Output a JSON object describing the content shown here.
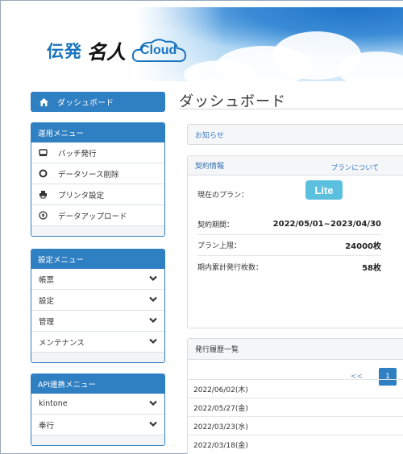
{
  "banner": {
    "logo_den": "伝発",
    "logo_meijin": "名人",
    "logo_cloud": "Cloud"
  },
  "sidebar": {
    "dashboard_label": "ダッシュボード",
    "operation_menu": {
      "title": "運用メニュー",
      "items": [
        {
          "label": "バッチ発行",
          "icon": "printer-tray-icon"
        },
        {
          "label": "データソース削除",
          "icon": "circle-icon"
        },
        {
          "label": "プリンタ設定",
          "icon": "printer-icon"
        },
        {
          "label": "データアップロード",
          "icon": "upload-icon"
        }
      ]
    },
    "settings_menu": {
      "title": "設定メニュー",
      "items": [
        {
          "label": "帳票"
        },
        {
          "label": "設定"
        },
        {
          "label": "管理"
        },
        {
          "label": "メンテナンス"
        }
      ]
    },
    "api_menu": {
      "title": "API連携メニュー",
      "items": [
        {
          "label": "kintone"
        },
        {
          "label": "奉行"
        }
      ]
    }
  },
  "main": {
    "page_title": "ダッシュボード",
    "notice": {
      "title": "お知らせ"
    },
    "contract": {
      "title": "契約情報",
      "about_link": "プランについて",
      "current_plan_label": "現在のプラン：",
      "current_plan_badge": "Lite",
      "period_label": "契約期間：",
      "period_value": "2022/05/01~2023/04/30",
      "limit_label": "プラン上限：",
      "limit_value": "24000枚",
      "issued_label": "期内累計発行枚数：",
      "issued_value": "58枚"
    },
    "history": {
      "title": "発行履歴一覧",
      "pager_prev": "<<",
      "pager_current": "1",
      "rows": [
        "2022/06/02(木)",
        "2022/05/27(金)",
        "2022/03/23(水)",
        "2022/03/18(金)"
      ]
    }
  },
  "colors": {
    "primary": "#2f7fc3",
    "badge": "#5bc0de"
  }
}
